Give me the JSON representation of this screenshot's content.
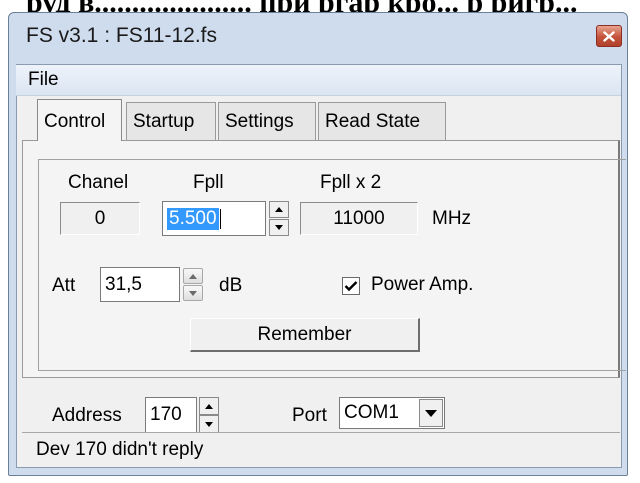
{
  "banner": {
    "text": "руд в..................... при ргар кро... р ригр..."
  },
  "window": {
    "title": "FS v3.1 : FS11-12.fs"
  },
  "menu": {
    "file": "File"
  },
  "tabs": [
    {
      "label": "Control",
      "active": true
    },
    {
      "label": "Startup",
      "active": false
    },
    {
      "label": "Settings",
      "active": false
    },
    {
      "label": "Read State",
      "active": false
    }
  ],
  "control": {
    "chanel_label": "Chanel",
    "chanel_value": "0",
    "fpll_label": "Fpll",
    "fpll_value": "5.500",
    "fpll2_label": "Fpll x 2",
    "fpll2_value": "11000",
    "unit_mhz": "MHz",
    "att_label": "Att",
    "att_value": "31,5",
    "unit_db": "dB",
    "power_amp_label": "Power Amp.",
    "power_amp_checked": true,
    "remember_label": "Remember"
  },
  "bottom": {
    "address_label": "Address",
    "address_value": "170",
    "port_label": "Port",
    "port_value": "COM1"
  },
  "status": {
    "text": "Dev 170 didn't reply"
  },
  "colors": {
    "title_bar": "#cfdced",
    "close_button": "#c4523b",
    "selection": "#3399ff"
  },
  "icons": {
    "close": "close-icon",
    "spin_up": "arrow-up-icon",
    "spin_down": "arrow-down-icon",
    "dropdown": "chevron-down-icon",
    "check": "checkmark-icon"
  }
}
